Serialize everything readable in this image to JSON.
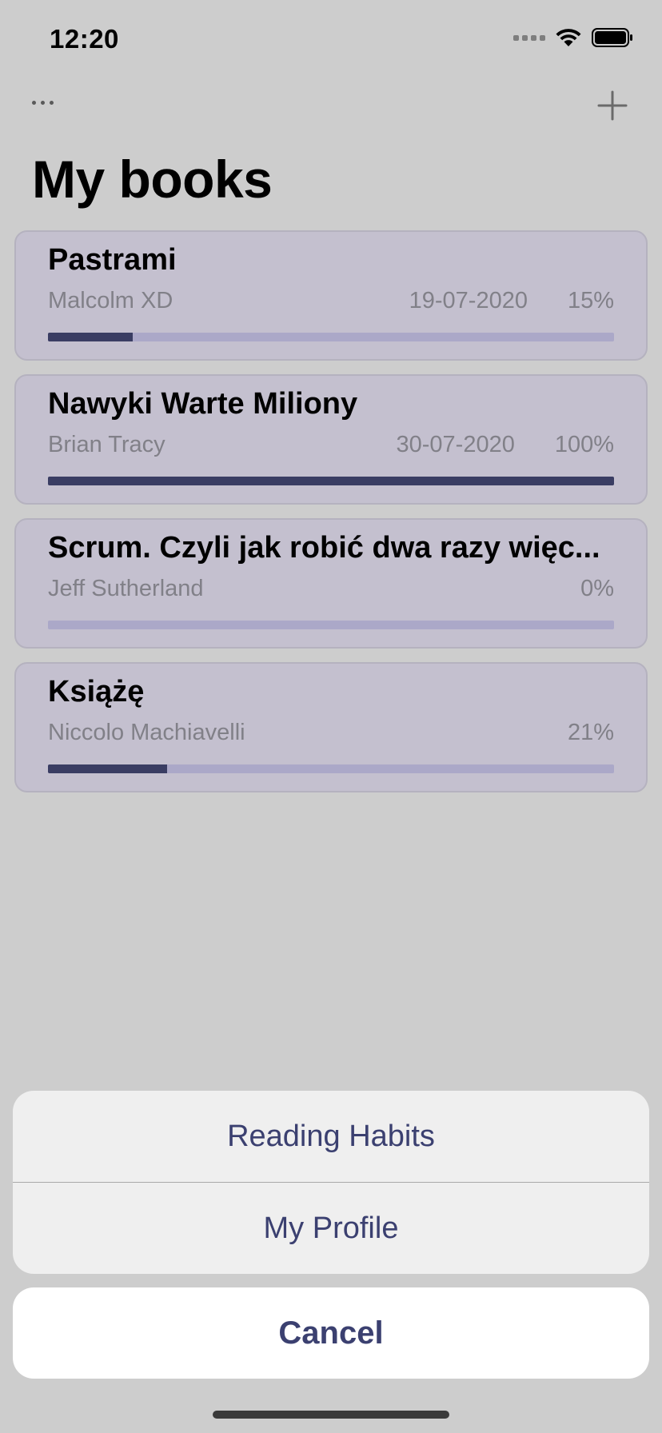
{
  "status_bar": {
    "time": "12:20"
  },
  "nav": {
    "more_icon": "ellipsis-icon",
    "add_icon": "plus-icon"
  },
  "page": {
    "title": "My books"
  },
  "books": [
    {
      "title": "Pastrami",
      "author": "Malcolm XD",
      "date": "19-07-2020",
      "percent": "15%",
      "progress": 0.15
    },
    {
      "title": "Nawyki Warte Miliony",
      "author": "Brian Tracy",
      "date": "30-07-2020",
      "percent": "100%",
      "progress": 1.0
    },
    {
      "title": "Scrum. Czyli jak robić dwa razy więc...",
      "author": "Jeff Sutherland",
      "date": "",
      "percent": "0%",
      "progress": 0.0
    },
    {
      "title": "Książę",
      "author": "Niccolo Machiavelli",
      "date": "",
      "percent": "21%",
      "progress": 0.21
    }
  ],
  "action_sheet": {
    "options": [
      {
        "label": "Reading Habits"
      },
      {
        "label": "My Profile"
      }
    ],
    "cancel_label": "Cancel"
  },
  "colors": {
    "background": "#cdcdcd",
    "card": "#c4c0cf",
    "progress_track": "#aba8c8",
    "progress_fill": "#3a3d63",
    "accent_text": "#3b4070"
  }
}
